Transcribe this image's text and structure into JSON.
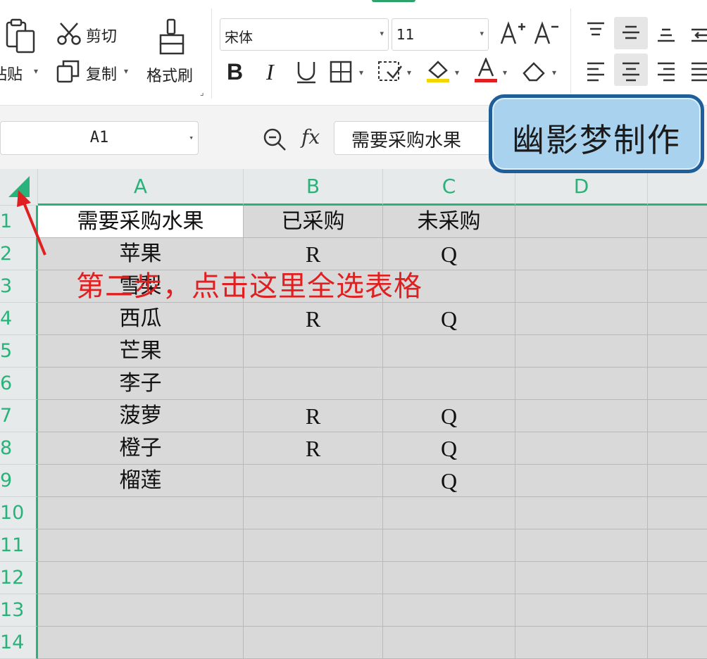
{
  "ribbon": {
    "paste_label": "粘贴",
    "cut_label": "剪切",
    "copy_label": "复制",
    "format_painter_label": "格式刷",
    "font_name": "宋体",
    "font_size": "11",
    "icons": [
      "paste-icon",
      "scissors-icon",
      "copy-icon",
      "format-painter-icon",
      "increase-font-icon",
      "decrease-font-icon",
      "bold-icon",
      "italic-icon",
      "underline-icon",
      "borders-icon",
      "cell-style-icon",
      "fill-color-icon",
      "font-color-icon",
      "clear-format-icon",
      "align-top-icon",
      "align-middle-icon",
      "align-bottom-icon",
      "wrap-icon",
      "align-left-icon",
      "align-center-icon",
      "align-right-icon",
      "justify-icon"
    ],
    "accent_color": "#2da36b",
    "font_color_underline": "#e02020",
    "fill_color_underline": "#f2d600"
  },
  "formula_bar": {
    "name_box": "A1",
    "formula_value": "需要采购水果",
    "fx_label": "fx"
  },
  "watermark": "幽影梦制作",
  "annotation": "第二步，点击这里全选表格",
  "grid": {
    "columns": [
      "A",
      "B",
      "C",
      "D"
    ],
    "rows": [
      "1",
      "2",
      "3",
      "4",
      "5",
      "6",
      "7",
      "8",
      "9",
      "10",
      "11",
      "12",
      "13",
      "14"
    ],
    "cells": [
      [
        "需要采购水果",
        "已采购",
        "未采购",
        ""
      ],
      [
        "苹果",
        "R",
        "Q",
        ""
      ],
      [
        "雪梨",
        "",
        "",
        ""
      ],
      [
        "西瓜",
        "R",
        "Q",
        ""
      ],
      [
        "芒果",
        "",
        "",
        ""
      ],
      [
        "李子",
        "",
        "",
        ""
      ],
      [
        "菠萝",
        "R",
        "Q",
        ""
      ],
      [
        "橙子",
        "R",
        "Q",
        ""
      ],
      [
        "榴莲",
        "",
        "Q",
        ""
      ],
      [
        "",
        "",
        "",
        ""
      ],
      [
        "",
        "",
        "",
        ""
      ],
      [
        "",
        "",
        "",
        ""
      ],
      [
        "",
        "",
        "",
        ""
      ],
      [
        "",
        "",
        "",
        ""
      ]
    ],
    "header_color": "#2ab27b",
    "selection_fill": "#d9d9d9"
  }
}
